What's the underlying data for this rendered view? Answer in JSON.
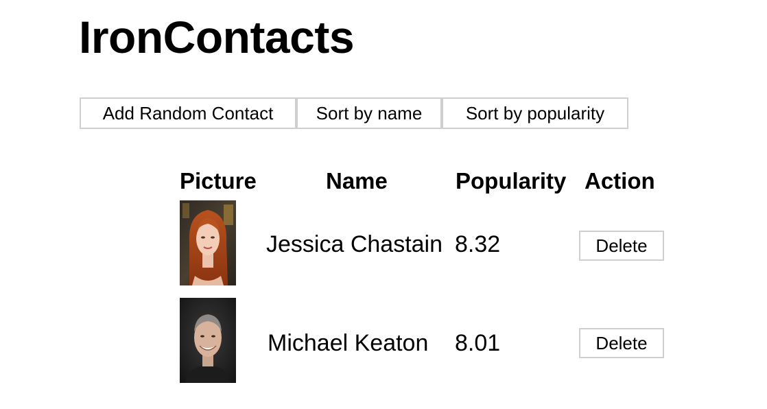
{
  "app": {
    "title": "IronContacts"
  },
  "toolbar": {
    "add_label": "Add Random Contact",
    "sort_name_label": "Sort by name",
    "sort_popularity_label": "Sort by popularity"
  },
  "table": {
    "headers": {
      "picture": "Picture",
      "name": "Name",
      "popularity": "Popularity",
      "action": "Action"
    },
    "rows": [
      {
        "name": "Jessica Chastain",
        "popularity": "8.32",
        "action_label": "Delete",
        "photo_alt": "Jessica Chastain"
      },
      {
        "name": "Michael Keaton",
        "popularity": "8.01",
        "action_label": "Delete",
        "photo_alt": "Michael Keaton"
      }
    ]
  },
  "colors": {
    "button_border": "#cfcfcf",
    "text": "#000000",
    "background": "#ffffff"
  }
}
